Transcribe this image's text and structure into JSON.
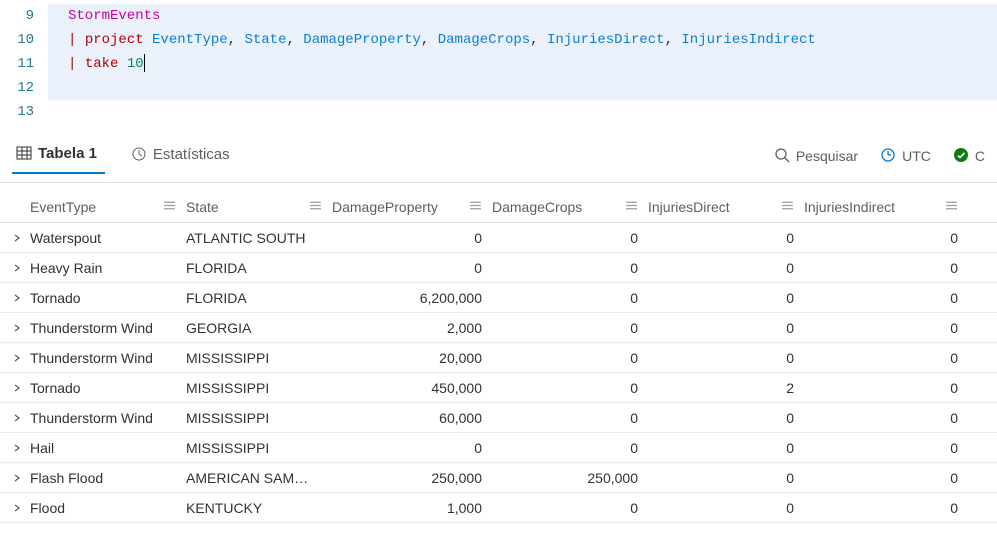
{
  "editor": {
    "lines": {
      "l9": {
        "n": "9"
      },
      "l10": {
        "n": "10"
      },
      "l11": {
        "n": "11"
      },
      "l12": {
        "n": "12"
      },
      "l13": {
        "n": "13"
      }
    },
    "tokens": {
      "table": "StormEvents",
      "pipe": "|",
      "project": "project",
      "take": "take",
      "comma": ",",
      "num10": "10",
      "cols": {
        "EventType": "EventType",
        "State": "State",
        "DamageProperty": "DamageProperty",
        "DamageCrops": "DamageCrops",
        "InjuriesDirect": "InjuriesDirect",
        "InjuriesIndirect": "InjuriesIndirect"
      }
    }
  },
  "tabs": {
    "table1": "Tabela 1",
    "stats": "Estatísticas"
  },
  "toolbar": {
    "search": "Pesquisar",
    "utc": "UTC",
    "status": "C"
  },
  "columns": {
    "EventType": "EventType",
    "State": "State",
    "DamageProperty": "DamageProperty",
    "DamageCrops": "DamageCrops",
    "InjuriesDirect": "InjuriesDirect",
    "InjuriesIndirect": "InjuriesIndirect"
  },
  "rows": [
    {
      "evt": "Waterspout",
      "state": "ATLANTIC SOUTH",
      "dp": "0",
      "dc": "0",
      "id": "0",
      "ii": "0"
    },
    {
      "evt": "Heavy Rain",
      "state": "FLORIDA",
      "dp": "0",
      "dc": "0",
      "id": "0",
      "ii": "0"
    },
    {
      "evt": "Tornado",
      "state": "FLORIDA",
      "dp": "6,200,000",
      "dc": "0",
      "id": "0",
      "ii": "0"
    },
    {
      "evt": "Thunderstorm Wind",
      "state": "GEORGIA",
      "dp": "2,000",
      "dc": "0",
      "id": "0",
      "ii": "0"
    },
    {
      "evt": "Thunderstorm Wind",
      "state": "MISSISSIPPI",
      "dp": "20,000",
      "dc": "0",
      "id": "0",
      "ii": "0"
    },
    {
      "evt": "Tornado",
      "state": "MISSISSIPPI",
      "dp": "450,000",
      "dc": "0",
      "id": "2",
      "ii": "0"
    },
    {
      "evt": "Thunderstorm Wind",
      "state": "MISSISSIPPI",
      "dp": "60,000",
      "dc": "0",
      "id": "0",
      "ii": "0"
    },
    {
      "evt": "Hail",
      "state": "MISSISSIPPI",
      "dp": "0",
      "dc": "0",
      "id": "0",
      "ii": "0"
    },
    {
      "evt": "Flash Flood",
      "state": "AMERICAN SAM…",
      "dp": "250,000",
      "dc": "250,000",
      "id": "0",
      "ii": "0"
    },
    {
      "evt": "Flood",
      "state": "KENTUCKY",
      "dp": "1,000",
      "dc": "0",
      "id": "0",
      "ii": "0"
    }
  ]
}
